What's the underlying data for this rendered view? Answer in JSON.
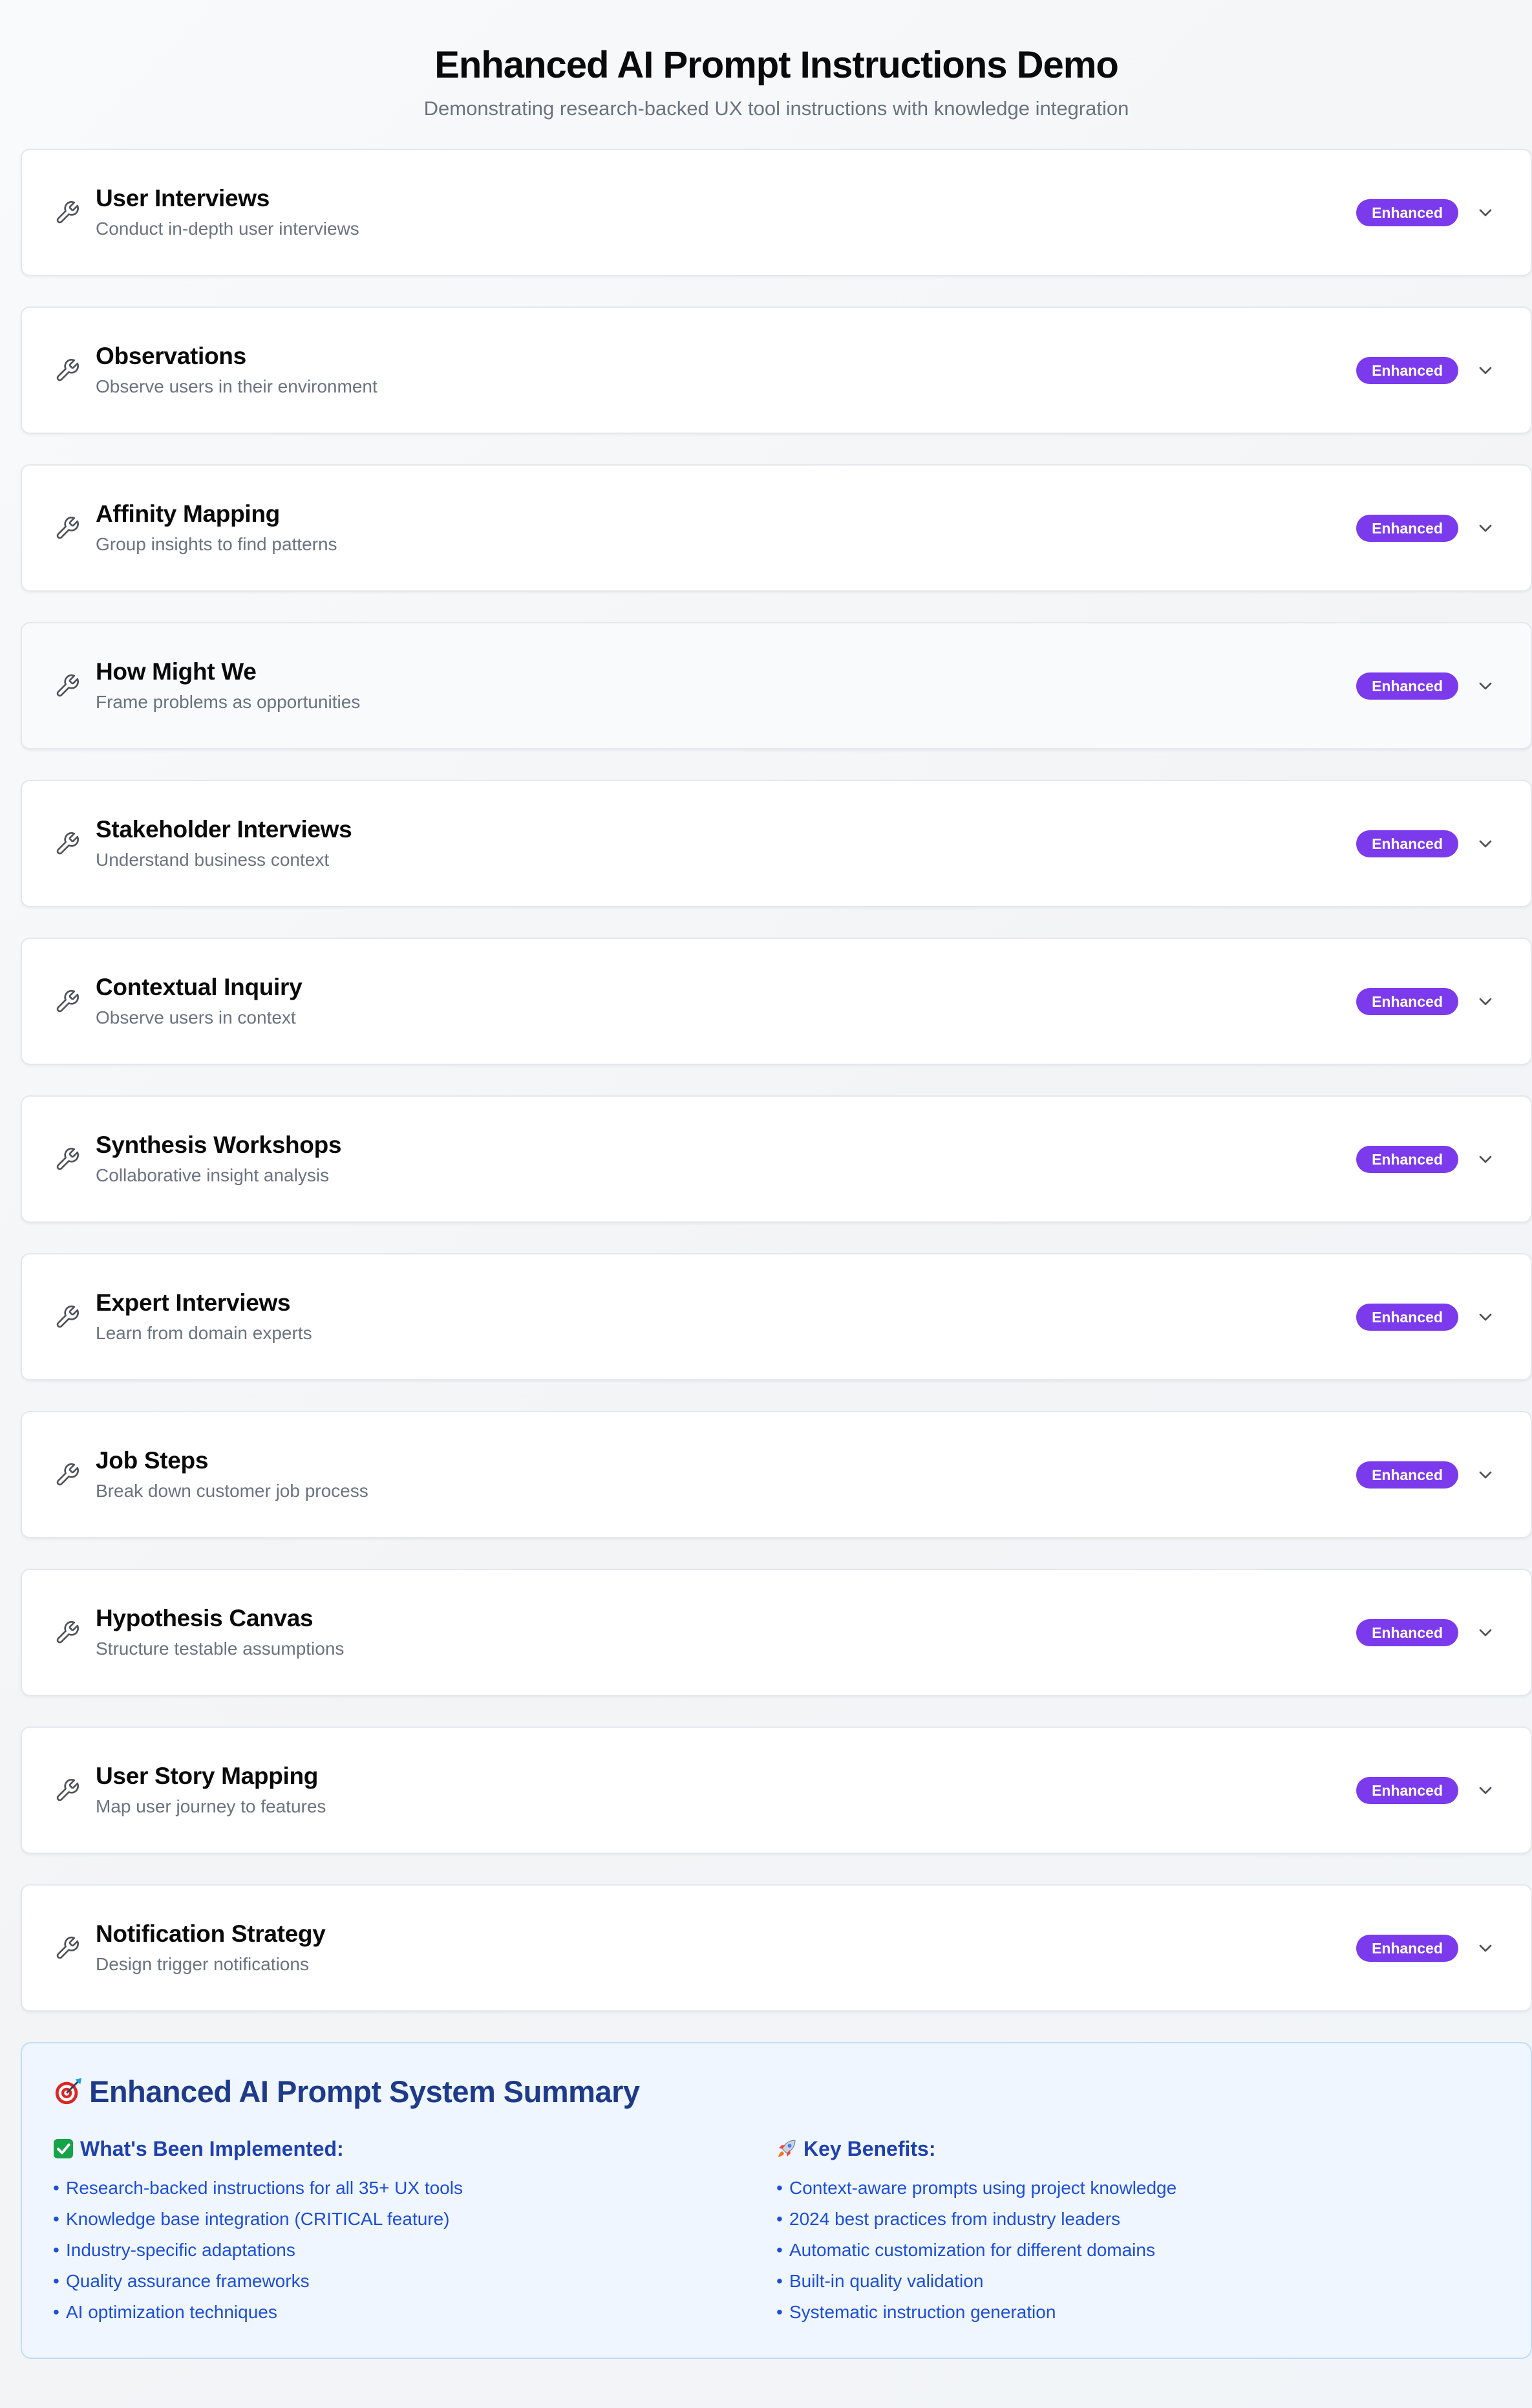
{
  "header": {
    "title": "Enhanced AI Prompt Instructions Demo",
    "subtitle": "Demonstrating research-backed UX tool instructions with knowledge integration"
  },
  "tools": [
    {
      "title": "User Interviews",
      "description": "Conduct in-depth user interviews",
      "badge": "Enhanced",
      "icon": "wrench-icon"
    },
    {
      "title": "Observations",
      "description": "Observe users in their environment",
      "badge": "Enhanced",
      "icon": "wrench-icon"
    },
    {
      "title": "Affinity Mapping",
      "description": "Group insights to find patterns",
      "badge": "Enhanced",
      "icon": "wrench-icon"
    },
    {
      "title": "How Might We",
      "description": "Frame problems as opportunities",
      "badge": "Enhanced",
      "icon": "wrench-icon"
    },
    {
      "title": "Stakeholder Interviews",
      "description": "Understand business context",
      "badge": "Enhanced",
      "icon": "wrench-icon"
    },
    {
      "title": "Contextual Inquiry",
      "description": "Observe users in context",
      "badge": "Enhanced",
      "icon": "wrench-icon"
    },
    {
      "title": "Synthesis Workshops",
      "description": "Collaborative insight analysis",
      "badge": "Enhanced",
      "icon": "wrench-icon"
    },
    {
      "title": "Expert Interviews",
      "description": "Learn from domain experts",
      "badge": "Enhanced",
      "icon": "wrench-icon"
    },
    {
      "title": "Job Steps",
      "description": "Break down customer job process",
      "badge": "Enhanced",
      "icon": "wrench-icon"
    },
    {
      "title": "Hypothesis Canvas",
      "description": "Structure testable assumptions",
      "badge": "Enhanced",
      "icon": "wrench-icon"
    },
    {
      "title": "User Story Mapping",
      "description": "Map user journey to features",
      "badge": "Enhanced",
      "icon": "wrench-icon"
    },
    {
      "title": "Notification Strategy",
      "description": "Design trigger notifications",
      "badge": "Enhanced",
      "icon": "wrench-icon"
    }
  ],
  "summary": {
    "icon": "target-icon",
    "title": "Enhanced AI Prompt System Summary",
    "implemented": {
      "icon": "check-mark-icon",
      "heading": "What's Been Implemented:",
      "items": [
        "Research-backed instructions for all 35+ UX tools",
        "Knowledge base integration (CRITICAL feature)",
        "Industry-specific adaptations",
        "Quality assurance frameworks",
        "AI optimization techniques"
      ]
    },
    "benefits": {
      "icon": "rocket-icon",
      "heading": "Key Benefits:",
      "items": [
        "Context-aware prompts using project knowledge",
        "2024 best practices from industry leaders",
        "Automatic customization for different domains",
        "Built-in quality validation",
        "Systematic instruction generation"
      ]
    }
  },
  "colors": {
    "badge": "#7c3aed",
    "summary_bg": "#eff6ff",
    "summary_border": "#bfdbfe",
    "summary_title": "#1e3a8a",
    "summary_text": "#1d4ed8"
  }
}
